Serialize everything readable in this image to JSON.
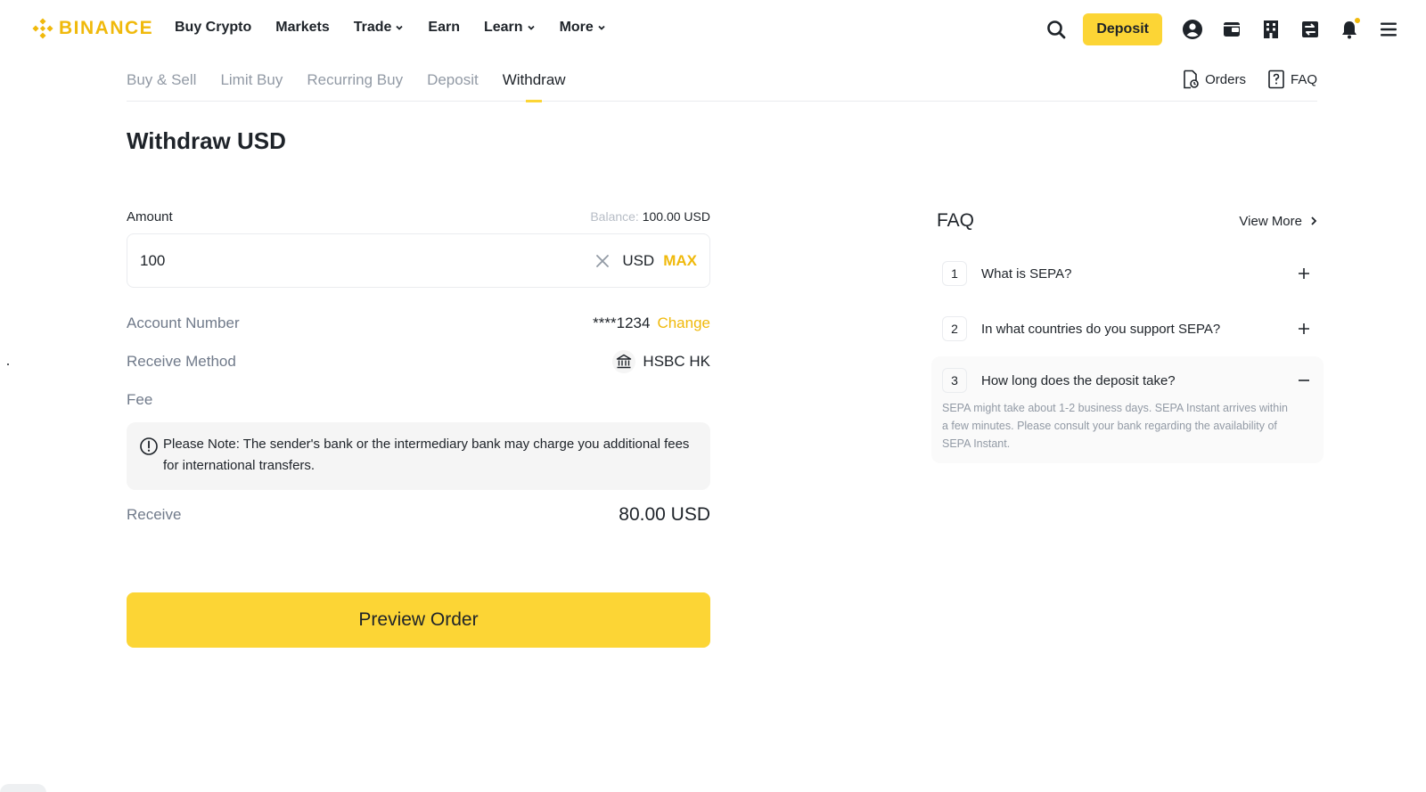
{
  "brand": {
    "name": "BINANCE",
    "color": "#f0b90b"
  },
  "nav": {
    "items": [
      {
        "label": "Buy Crypto",
        "dropdown": false
      },
      {
        "label": "Markets",
        "dropdown": false
      },
      {
        "label": "Trade",
        "dropdown": true
      },
      {
        "label": "Earn",
        "dropdown": false
      },
      {
        "label": "Learn",
        "dropdown": true
      },
      {
        "label": "More",
        "dropdown": true
      }
    ],
    "deposit_label": "Deposit",
    "icons": [
      "search-icon",
      "user-icon",
      "wallet-icon",
      "building-icon",
      "transfer-icon",
      "bell-icon",
      "menu-icon"
    ]
  },
  "subnav": {
    "tabs": [
      "Buy & Sell",
      "Limit Buy",
      "Recurring Buy",
      "Deposit",
      "Withdraw"
    ],
    "active_tab": "Withdraw",
    "orders_label": "Orders",
    "faq_label": "FAQ"
  },
  "page": {
    "title": "Withdraw USD"
  },
  "form": {
    "amount_label": "Amount",
    "balance_label": "Balance:",
    "balance_value": "100.00 USD",
    "amount_value": "100",
    "currency": "USD",
    "max_label": "MAX",
    "account_number_label": "Account Number",
    "account_number_value": "****1234",
    "change_label": "Change",
    "receive_method_label": "Receive Method",
    "receive_method_value": "HSBC HK",
    "fee_label": "Fee",
    "note_text": "Please Note: The sender's bank or the intermediary bank may charge you additional fees for international transfers.",
    "receive_label": "Receive",
    "receive_value": "80.00 USD",
    "preview_button": "Preview Order"
  },
  "faq": {
    "title": "FAQ",
    "view_more": "View More",
    "items": [
      {
        "num": "1",
        "question": "What is SEPA?",
        "expanded": false
      },
      {
        "num": "2",
        "question": "In what countries do you support SEPA?",
        "expanded": false
      },
      {
        "num": "3",
        "question": "How long does the deposit take?",
        "expanded": true,
        "answer": "SEPA might take about 1-2 business days. SEPA Instant arrives within a few minutes. Please consult your bank regarding the availability of SEPA Instant."
      }
    ]
  },
  "colors": {
    "accent": "#fcd535",
    "text": "#1e2329",
    "muted": "#707a8a"
  }
}
